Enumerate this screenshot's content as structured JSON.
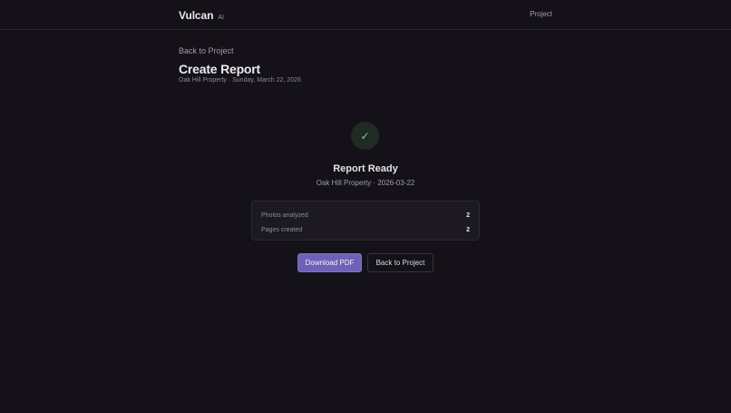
{
  "header": {
    "brand_name": "Vulcan",
    "brand_badge": "AI",
    "nav_project": "Project"
  },
  "page": {
    "back_link": "Back to Project",
    "title": "Create Report",
    "subtitle": "Oak Hill Property · Sunday, March 22, 2026"
  },
  "status": {
    "icon": "check-icon",
    "icon_glyph": "✓",
    "title": "Report Ready",
    "subtitle": "Oak Hill Property · 2026-03-22"
  },
  "stats": [
    {
      "label": "Photos analyzed",
      "value": "2"
    },
    {
      "label": "Pages created",
      "value": "2"
    }
  ],
  "actions": {
    "download_label": "Download PDF",
    "back_label": "Back to Project"
  },
  "colors": {
    "background": "#141118",
    "accent": "#6e62b8",
    "success": "#7fcf95"
  }
}
